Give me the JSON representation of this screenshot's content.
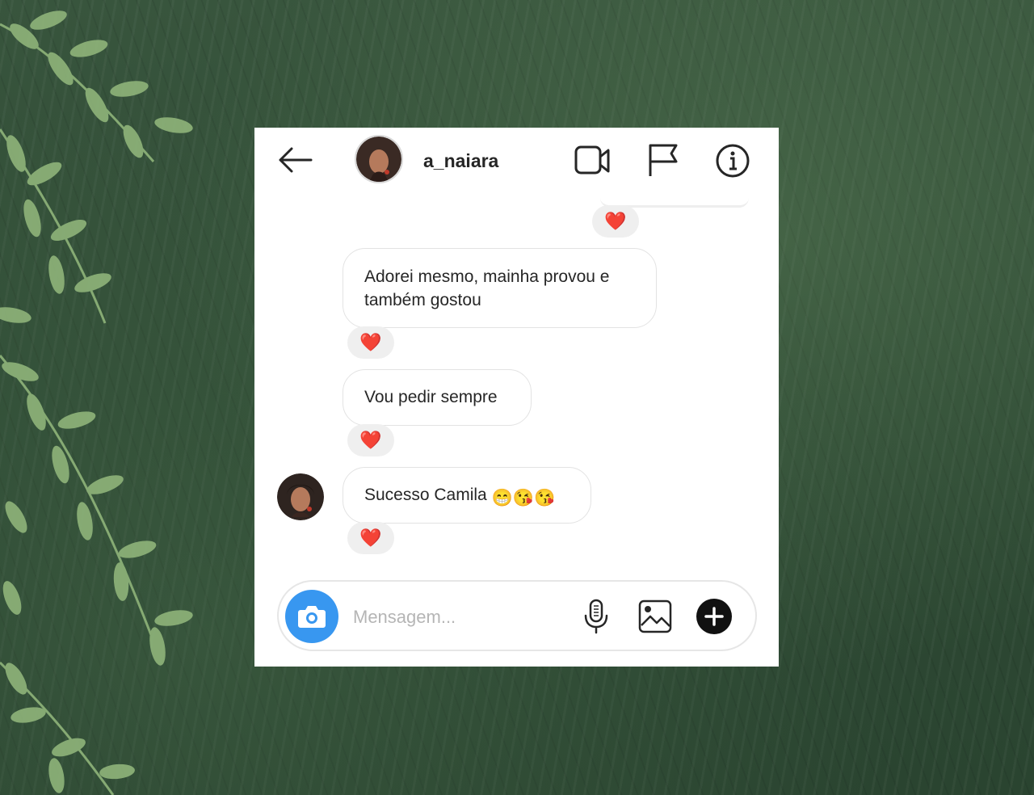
{
  "header": {
    "username": "a_naiara",
    "icons": {
      "back": "back-arrow-icon",
      "video": "video-call-icon",
      "flag": "flag-icon",
      "info": "info-icon"
    }
  },
  "messages": [
    {
      "text": "Adorei mesmo, mainha provou e também gostou",
      "reaction": "❤️"
    },
    {
      "text": "Vou pedir sempre",
      "reaction": "❤️"
    },
    {
      "text": "Sucesso Camila",
      "emoji": "😁😘😘",
      "reaction": "❤️"
    }
  ],
  "top_reaction": "❤️",
  "composer": {
    "placeholder": "Mensagem...",
    "icons": {
      "camera": "camera-icon",
      "mic": "microphone-icon",
      "gallery": "gallery-icon",
      "plus": "plus-icon"
    }
  },
  "colors": {
    "accent": "#3897f0",
    "heart": "#e0172b",
    "background": "#2f4a34"
  }
}
